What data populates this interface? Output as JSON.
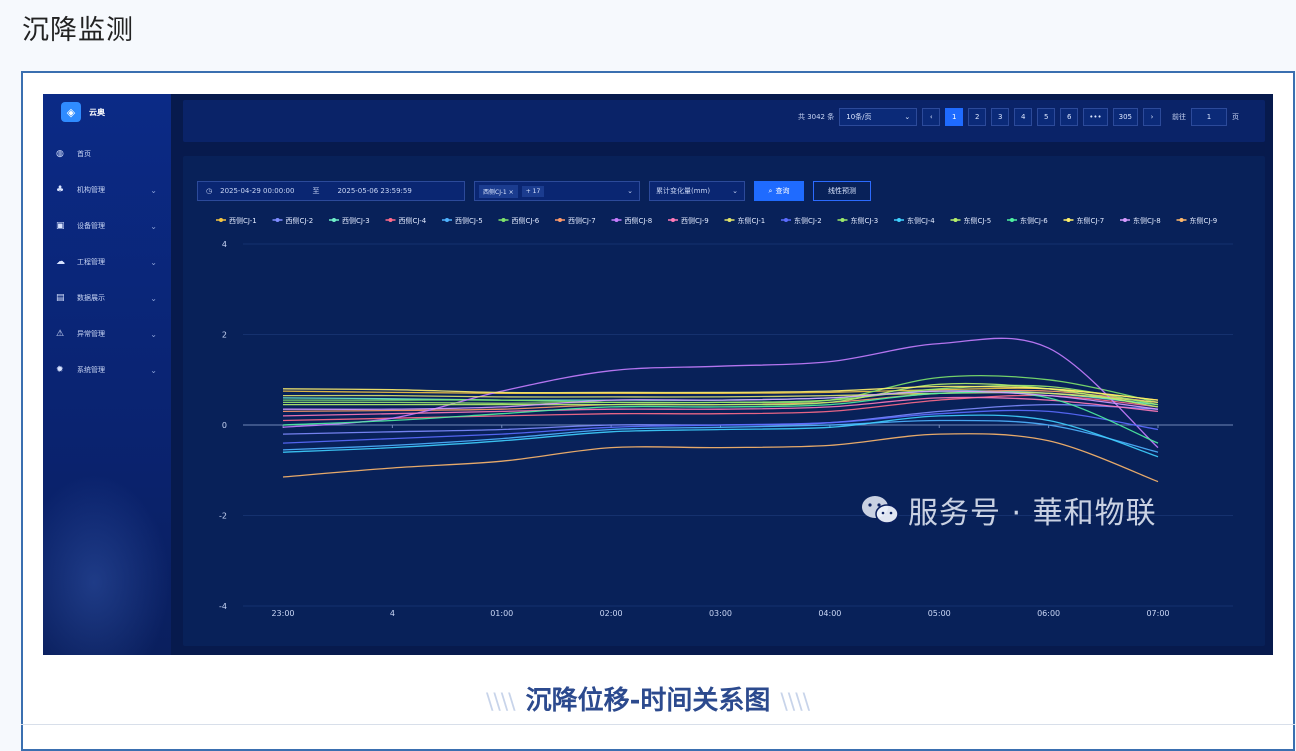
{
  "page": {
    "title": "沉降监测",
    "caption": "沉降位移-时间关系图"
  },
  "app": {
    "logo_text": "云奥",
    "nav": [
      {
        "label": "首页",
        "icon": "dashboard-icon",
        "glyph": "◍",
        "chevron": false
      },
      {
        "label": "机构管理",
        "icon": "org-tree-icon",
        "glyph": "♣",
        "chevron": true
      },
      {
        "label": "设备管理",
        "icon": "monitor-icon",
        "glyph": "▣",
        "chevron": true
      },
      {
        "label": "工程管理",
        "icon": "cloud-icon",
        "glyph": "☁",
        "chevron": true
      },
      {
        "label": "数据展示",
        "icon": "document-icon",
        "glyph": "▤",
        "chevron": true
      },
      {
        "label": "异常管理",
        "icon": "warning-icon",
        "glyph": "⚠",
        "chevron": true
      },
      {
        "label": "系统管理",
        "icon": "gear-icon",
        "glyph": "✹",
        "chevron": true
      }
    ]
  },
  "pager": {
    "total": "共 3042 条",
    "page_size": "10条/页",
    "pages": [
      "1",
      "2",
      "3",
      "4",
      "5",
      "6",
      "•••",
      "305"
    ],
    "active": "1",
    "goto_label": "前往",
    "goto_value": "1",
    "goto_unit": "页"
  },
  "filters": {
    "start": "2025-04-29 00:00:00",
    "sep": "至",
    "end": "2025-05-06 23:59:59",
    "tag": "西侧CJ-1",
    "tag_more": "+ 17",
    "metric": "累计变化量(mm)",
    "query": "查询",
    "predict": "线性预测"
  },
  "watermark": {
    "text": "服务号 · 華和物联"
  },
  "chart_data": {
    "type": "line",
    "x": [
      "23:00",
      "4",
      "01:00",
      "02:00",
      "03:00",
      "04:00",
      "05:00",
      "06:00",
      "07:00"
    ],
    "y_ticks": [
      4,
      2,
      0,
      -2,
      -4
    ],
    "ylim": [
      -4,
      4
    ],
    "grid": true,
    "legend_position": "top",
    "series": [
      {
        "name": "西侧CJ-1",
        "color": "#f5c542",
        "values": [
          0.75,
          0.72,
          0.7,
          0.7,
          0.7,
          0.72,
          0.78,
          0.8,
          0.55
        ]
      },
      {
        "name": "西侧CJ-2",
        "color": "#7f8cff",
        "values": [
          -0.2,
          -0.15,
          -0.1,
          0.0,
          0.0,
          0.05,
          0.3,
          0.45,
          0.35
        ]
      },
      {
        "name": "西侧CJ-3",
        "color": "#6ff0c9",
        "values": [
          0.6,
          0.58,
          0.55,
          0.55,
          0.55,
          0.6,
          0.75,
          0.7,
          0.45
        ]
      },
      {
        "name": "西侧CJ-4",
        "color": "#ff6b8a",
        "values": [
          0.1,
          0.15,
          0.2,
          0.25,
          0.25,
          0.3,
          0.55,
          0.65,
          0.4
        ]
      },
      {
        "name": "西侧CJ-5",
        "color": "#4fb3ff",
        "values": [
          -0.55,
          -0.45,
          -0.3,
          -0.1,
          -0.05,
          0.0,
          0.1,
          0.0,
          -0.6
        ]
      },
      {
        "name": "西侧CJ-6",
        "color": "#7ee36b",
        "values": [
          0.55,
          0.55,
          0.55,
          0.5,
          0.5,
          0.55,
          1.05,
          1.0,
          0.5
        ]
      },
      {
        "name": "西侧CJ-7",
        "color": "#ff9a6b",
        "values": [
          0.3,
          0.32,
          0.35,
          0.45,
          0.45,
          0.5,
          0.7,
          0.75,
          0.5
        ]
      },
      {
        "name": "西侧CJ-8",
        "color": "#c77dff",
        "values": [
          -0.05,
          0.15,
          0.75,
          1.2,
          1.3,
          1.4,
          1.8,
          1.7,
          -0.5
        ]
      },
      {
        "name": "西侧CJ-9",
        "color": "#ff7ab8",
        "values": [
          0.2,
          0.25,
          0.3,
          0.35,
          0.35,
          0.4,
          0.6,
          0.55,
          0.3
        ]
      },
      {
        "name": "东侧CJ-1",
        "color": "#e0e36b",
        "values": [
          0.65,
          0.65,
          0.62,
          0.62,
          0.62,
          0.65,
          0.7,
          0.7,
          0.5
        ]
      },
      {
        "name": "东侧CJ-2",
        "color": "#5b6cff",
        "values": [
          -0.4,
          -0.3,
          -0.2,
          -0.05,
          0.0,
          0.05,
          0.25,
          0.3,
          -0.1
        ]
      },
      {
        "name": "东侧CJ-3",
        "color": "#9be86b",
        "values": [
          0.5,
          0.5,
          0.48,
          0.5,
          0.5,
          0.55,
          0.8,
          0.85,
          0.45
        ]
      },
      {
        "name": "东侧CJ-4",
        "color": "#3fd0ff",
        "values": [
          -0.6,
          -0.5,
          -0.35,
          -0.15,
          -0.1,
          -0.05,
          0.2,
          0.1,
          -0.7
        ]
      },
      {
        "name": "东侧CJ-5",
        "color": "#b6f06b",
        "values": [
          0.45,
          0.45,
          0.45,
          0.45,
          0.45,
          0.5,
          0.9,
          0.8,
          0.4
        ]
      },
      {
        "name": "东侧CJ-6",
        "color": "#4ef0a0",
        "values": [
          0.0,
          0.1,
          0.25,
          0.4,
          0.4,
          0.45,
          0.7,
          0.6,
          -0.4
        ]
      },
      {
        "name": "东侧CJ-7",
        "color": "#fff06b",
        "values": [
          0.8,
          0.78,
          0.72,
          0.72,
          0.72,
          0.75,
          0.85,
          0.8,
          0.55
        ]
      },
      {
        "name": "东侧CJ-8",
        "color": "#d69bff",
        "values": [
          0.35,
          0.35,
          0.4,
          0.55,
          0.55,
          0.6,
          0.75,
          0.65,
          0.35
        ]
      },
      {
        "name": "东侧CJ-9",
        "color": "#ffb86b",
        "values": [
          -1.15,
          -0.95,
          -0.8,
          -0.5,
          -0.5,
          -0.45,
          -0.2,
          -0.35,
          -1.25
        ]
      }
    ]
  }
}
